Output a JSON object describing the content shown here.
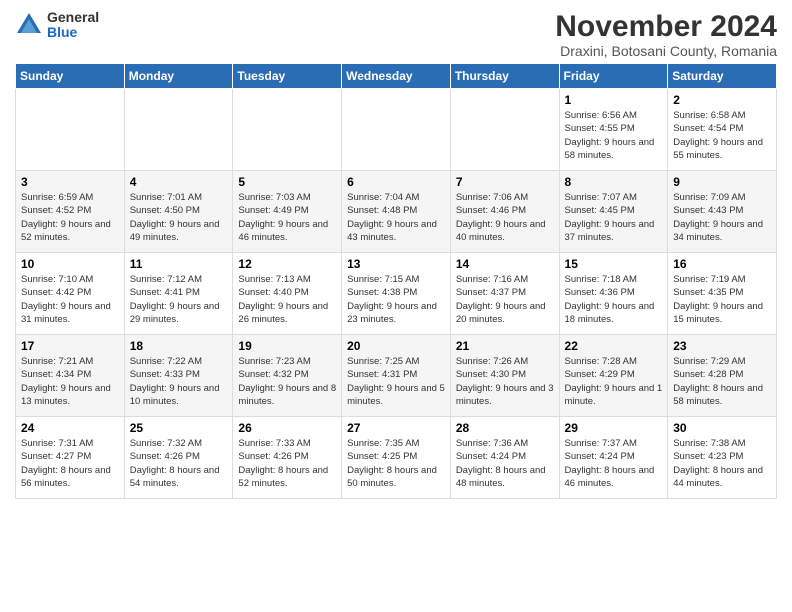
{
  "logo": {
    "general": "General",
    "blue": "Blue"
  },
  "title": "November 2024",
  "subtitle": "Draxini, Botosani County, Romania",
  "days_header": [
    "Sunday",
    "Monday",
    "Tuesday",
    "Wednesday",
    "Thursday",
    "Friday",
    "Saturday"
  ],
  "weeks": [
    [
      {
        "day": "",
        "info": ""
      },
      {
        "day": "",
        "info": ""
      },
      {
        "day": "",
        "info": ""
      },
      {
        "day": "",
        "info": ""
      },
      {
        "day": "",
        "info": ""
      },
      {
        "day": "1",
        "info": "Sunrise: 6:56 AM\nSunset: 4:55 PM\nDaylight: 9 hours and 58 minutes."
      },
      {
        "day": "2",
        "info": "Sunrise: 6:58 AM\nSunset: 4:54 PM\nDaylight: 9 hours and 55 minutes."
      }
    ],
    [
      {
        "day": "3",
        "info": "Sunrise: 6:59 AM\nSunset: 4:52 PM\nDaylight: 9 hours and 52 minutes."
      },
      {
        "day": "4",
        "info": "Sunrise: 7:01 AM\nSunset: 4:50 PM\nDaylight: 9 hours and 49 minutes."
      },
      {
        "day": "5",
        "info": "Sunrise: 7:03 AM\nSunset: 4:49 PM\nDaylight: 9 hours and 46 minutes."
      },
      {
        "day": "6",
        "info": "Sunrise: 7:04 AM\nSunset: 4:48 PM\nDaylight: 9 hours and 43 minutes."
      },
      {
        "day": "7",
        "info": "Sunrise: 7:06 AM\nSunset: 4:46 PM\nDaylight: 9 hours and 40 minutes."
      },
      {
        "day": "8",
        "info": "Sunrise: 7:07 AM\nSunset: 4:45 PM\nDaylight: 9 hours and 37 minutes."
      },
      {
        "day": "9",
        "info": "Sunrise: 7:09 AM\nSunset: 4:43 PM\nDaylight: 9 hours and 34 minutes."
      }
    ],
    [
      {
        "day": "10",
        "info": "Sunrise: 7:10 AM\nSunset: 4:42 PM\nDaylight: 9 hours and 31 minutes."
      },
      {
        "day": "11",
        "info": "Sunrise: 7:12 AM\nSunset: 4:41 PM\nDaylight: 9 hours and 29 minutes."
      },
      {
        "day": "12",
        "info": "Sunrise: 7:13 AM\nSunset: 4:40 PM\nDaylight: 9 hours and 26 minutes."
      },
      {
        "day": "13",
        "info": "Sunrise: 7:15 AM\nSunset: 4:38 PM\nDaylight: 9 hours and 23 minutes."
      },
      {
        "day": "14",
        "info": "Sunrise: 7:16 AM\nSunset: 4:37 PM\nDaylight: 9 hours and 20 minutes."
      },
      {
        "day": "15",
        "info": "Sunrise: 7:18 AM\nSunset: 4:36 PM\nDaylight: 9 hours and 18 minutes."
      },
      {
        "day": "16",
        "info": "Sunrise: 7:19 AM\nSunset: 4:35 PM\nDaylight: 9 hours and 15 minutes."
      }
    ],
    [
      {
        "day": "17",
        "info": "Sunrise: 7:21 AM\nSunset: 4:34 PM\nDaylight: 9 hours and 13 minutes."
      },
      {
        "day": "18",
        "info": "Sunrise: 7:22 AM\nSunset: 4:33 PM\nDaylight: 9 hours and 10 minutes."
      },
      {
        "day": "19",
        "info": "Sunrise: 7:23 AM\nSunset: 4:32 PM\nDaylight: 9 hours and 8 minutes."
      },
      {
        "day": "20",
        "info": "Sunrise: 7:25 AM\nSunset: 4:31 PM\nDaylight: 9 hours and 5 minutes."
      },
      {
        "day": "21",
        "info": "Sunrise: 7:26 AM\nSunset: 4:30 PM\nDaylight: 9 hours and 3 minutes."
      },
      {
        "day": "22",
        "info": "Sunrise: 7:28 AM\nSunset: 4:29 PM\nDaylight: 9 hours and 1 minute."
      },
      {
        "day": "23",
        "info": "Sunrise: 7:29 AM\nSunset: 4:28 PM\nDaylight: 8 hours and 58 minutes."
      }
    ],
    [
      {
        "day": "24",
        "info": "Sunrise: 7:31 AM\nSunset: 4:27 PM\nDaylight: 8 hours and 56 minutes."
      },
      {
        "day": "25",
        "info": "Sunrise: 7:32 AM\nSunset: 4:26 PM\nDaylight: 8 hours and 54 minutes."
      },
      {
        "day": "26",
        "info": "Sunrise: 7:33 AM\nSunset: 4:26 PM\nDaylight: 8 hours and 52 minutes."
      },
      {
        "day": "27",
        "info": "Sunrise: 7:35 AM\nSunset: 4:25 PM\nDaylight: 8 hours and 50 minutes."
      },
      {
        "day": "28",
        "info": "Sunrise: 7:36 AM\nSunset: 4:24 PM\nDaylight: 8 hours and 48 minutes."
      },
      {
        "day": "29",
        "info": "Sunrise: 7:37 AM\nSunset: 4:24 PM\nDaylight: 8 hours and 46 minutes."
      },
      {
        "day": "30",
        "info": "Sunrise: 7:38 AM\nSunset: 4:23 PM\nDaylight: 8 hours and 44 minutes."
      }
    ]
  ]
}
